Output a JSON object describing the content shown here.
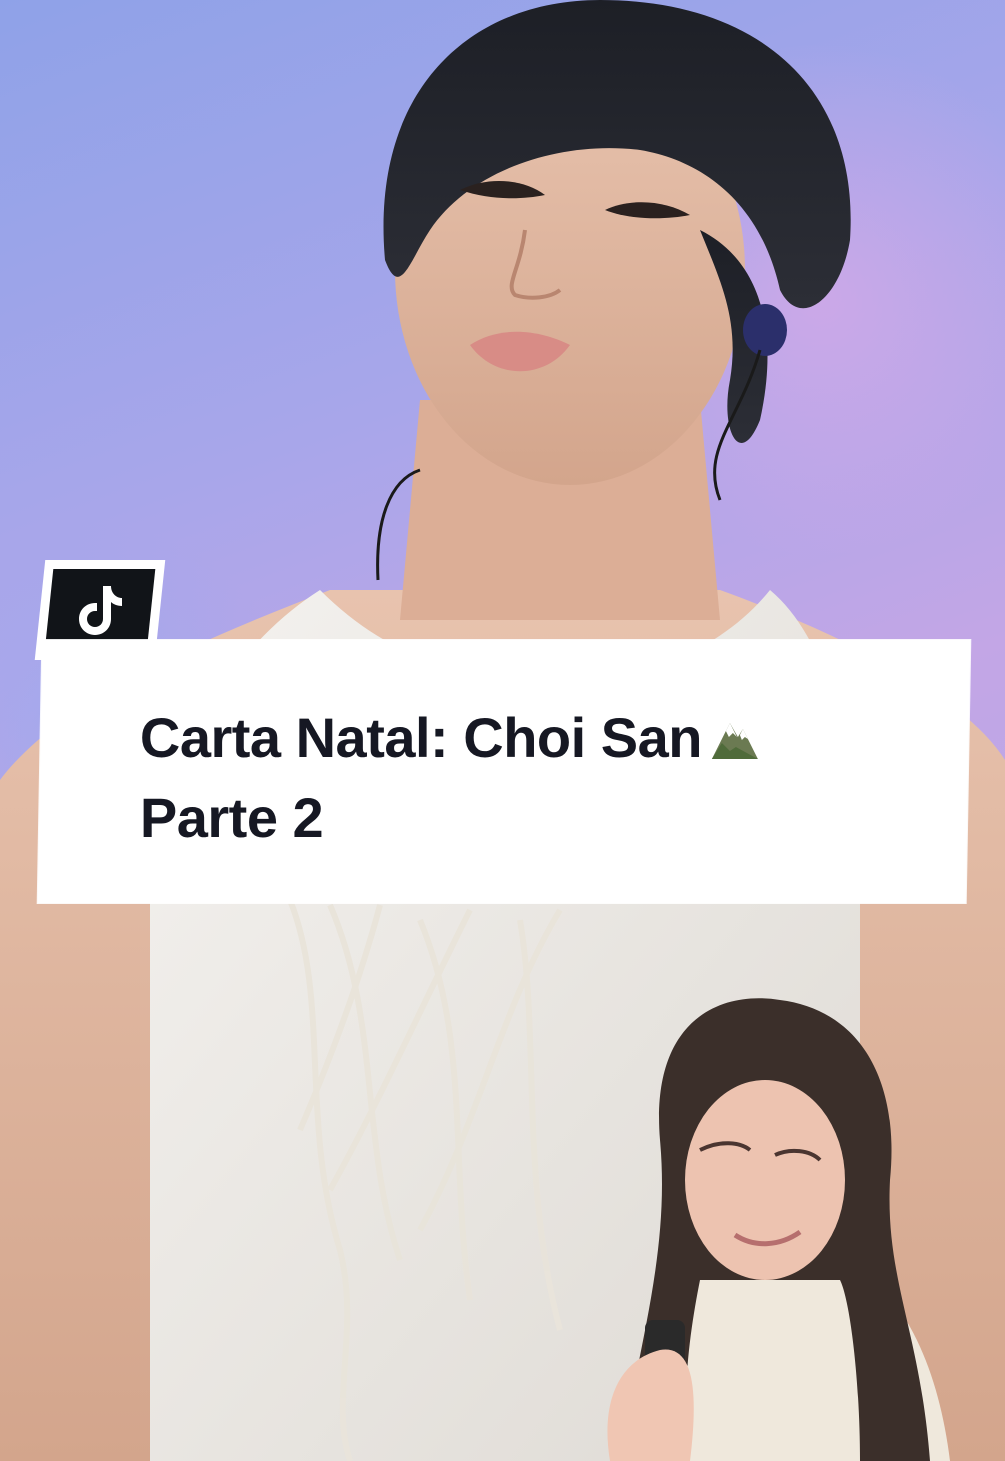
{
  "caption": {
    "line1": "Carta Natal: Choi San",
    "line2": "Parte 2",
    "emoji_icon": "snow-capped-mountain-icon"
  },
  "badge": {
    "icon": "tiktok-logo-icon"
  },
  "colors": {
    "sky_top": "#8fa2e8",
    "sky_mid": "#c3a6e6",
    "caption_bg": "#ffffff",
    "caption_text": "#161823",
    "badge_bg": "#111418"
  }
}
